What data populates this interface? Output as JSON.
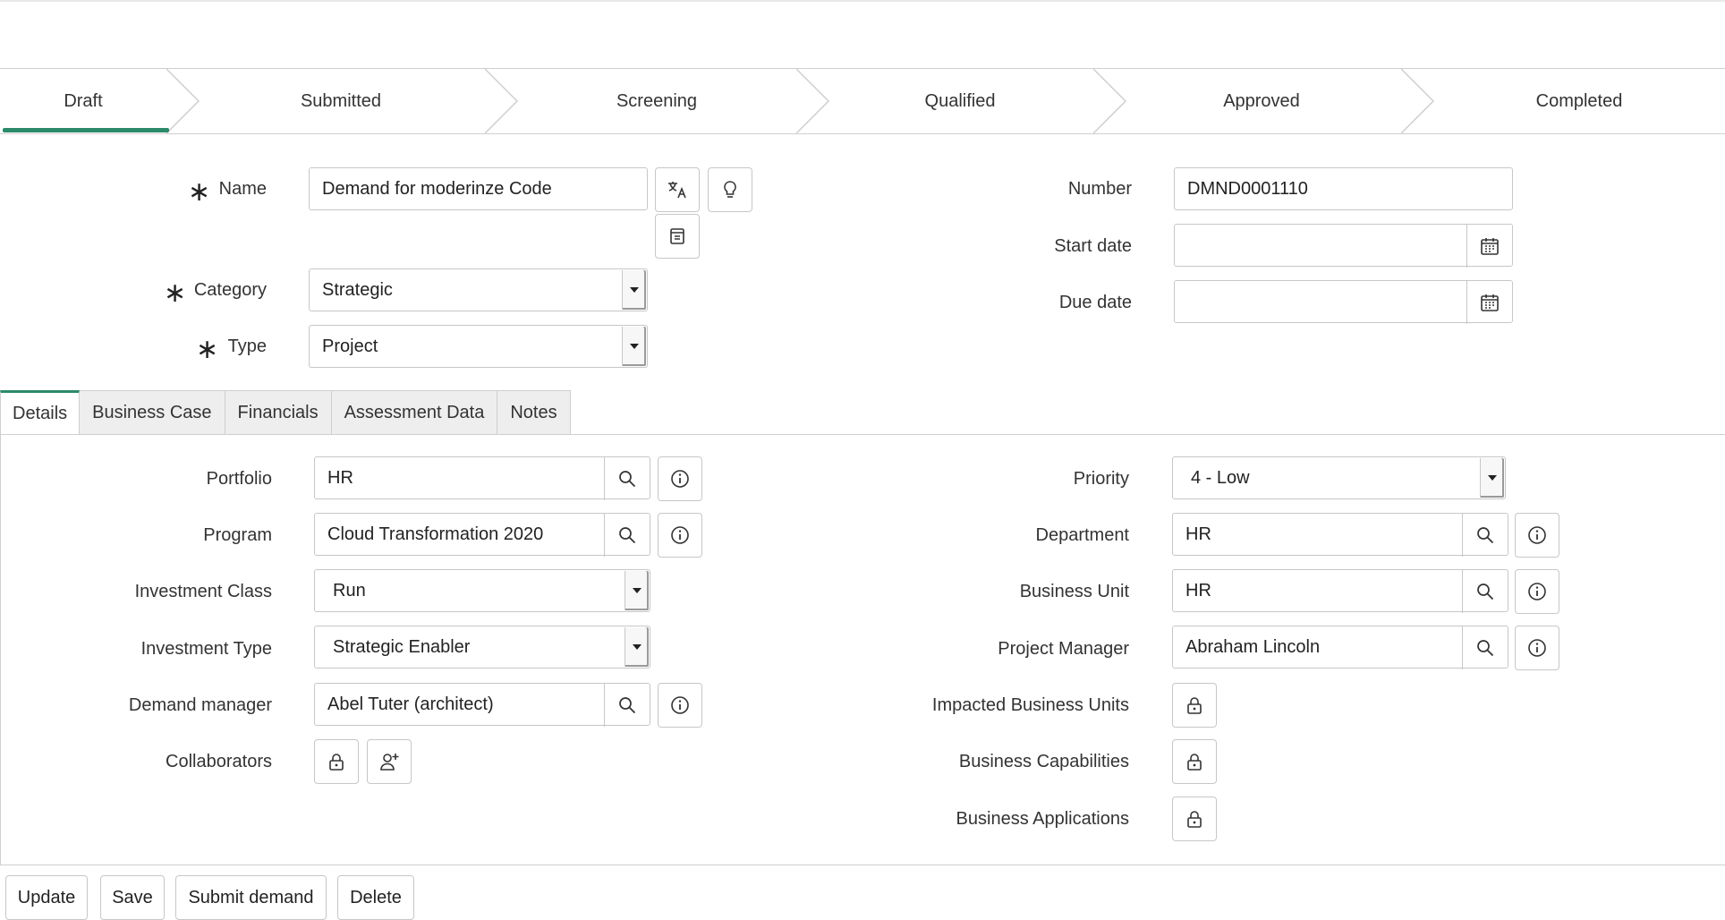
{
  "stages": [
    "Draft",
    "Submitted",
    "Screening",
    "Qualified",
    "Approved",
    "Completed"
  ],
  "colors": {
    "accent": "#2b8a6a",
    "border": "#c7c7c7",
    "tab_inactive": "#eeeeee"
  },
  "header_form": {
    "name_label": "Name",
    "name_value": "Demand for moderinze Code",
    "category_label": "Category",
    "category_value": "Strategic",
    "type_label": "Type",
    "type_value": "Project",
    "number_label": "Number",
    "number_value": "DMND0001110",
    "start_date_label": "Start date",
    "start_date_value": "",
    "due_date_label": "Due date",
    "due_date_value": ""
  },
  "tabs": [
    "Details",
    "Business Case",
    "Financials",
    "Assessment Data",
    "Notes"
  ],
  "details": {
    "portfolio_label": "Portfolio",
    "portfolio_value": "HR",
    "program_label": "Program",
    "program_value": "Cloud Transformation 2020",
    "investment_class_label": "Investment Class",
    "investment_class_value": "Run",
    "investment_type_label": "Investment Type",
    "investment_type_value": "Strategic Enabler",
    "demand_manager_label": "Demand manager",
    "demand_manager_value": "Abel Tuter (architect)",
    "collaborators_label": "Collaborators",
    "priority_label": "Priority",
    "priority_value": "4 - Low",
    "department_label": "Department",
    "department_value": "HR",
    "business_unit_label": "Business Unit",
    "business_unit_value": "HR",
    "project_manager_label": "Project Manager",
    "project_manager_value": "Abraham Lincoln",
    "impacted_bu_label": "Impacted Business Units",
    "business_capabilities_label": "Business Capabilities",
    "business_applications_label": "Business Applications"
  },
  "actions": [
    "Update",
    "Save",
    "Submit demand",
    "Delete"
  ]
}
